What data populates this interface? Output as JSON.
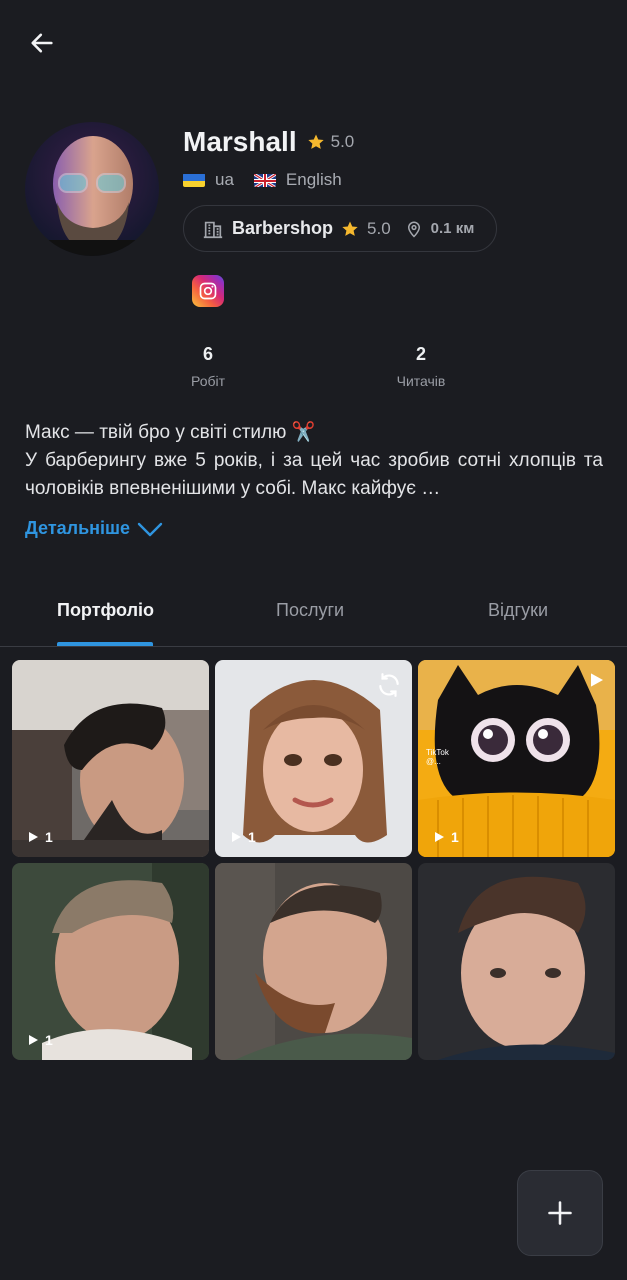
{
  "profile": {
    "name": "Marshall",
    "rating": "5.0",
    "languages": [
      {
        "code": "ua",
        "label": "ua",
        "flag": "ukraine-flag"
      },
      {
        "code": "en",
        "label": "English",
        "flag": "uk-flag"
      }
    ]
  },
  "shop": {
    "name": "Barbershop",
    "rating": "5.0",
    "distance": "0.1 км"
  },
  "social": {
    "icon": "instagram-icon"
  },
  "stats": [
    {
      "value": "6",
      "label": "Робіт"
    },
    {
      "value": "2",
      "label": "Читачів"
    }
  ],
  "bio": {
    "line1": "Макс — твій бро у світі стилю ✂️",
    "line2": "У барберингу вже 5 років, і за цей час зробив сотні хлопців та чоловіків впевненішими у собі. Макс кайфує …",
    "more_label": "Детальніше"
  },
  "tabs": [
    {
      "label": "Портфоліо",
      "active": true
    },
    {
      "label": "Послуги",
      "active": false
    },
    {
      "label": "Відгуки",
      "active": false
    }
  ],
  "portfolio": [
    {
      "kind": "video",
      "count": "1",
      "subject": "barber-fade-side-profile"
    },
    {
      "kind": "video",
      "count": "1",
      "subject": "woman-bob-haircut",
      "corner_icon": "refresh-icon"
    },
    {
      "kind": "video",
      "count": "1",
      "subject": "black-cat-tiktok",
      "corner_icon": "play-icon",
      "overlay_text": "TikTok",
      "overlay_handle": "@..."
    },
    {
      "kind": "video",
      "count": "1",
      "subject": "crew-cut-profile"
    },
    {
      "kind": "photo",
      "subject": "high-fade-beard"
    },
    {
      "kind": "photo",
      "subject": "textured-crop"
    }
  ],
  "colors": {
    "background": "#1b1c21",
    "accent": "#2f95e0",
    "star": "#f5b82e"
  }
}
